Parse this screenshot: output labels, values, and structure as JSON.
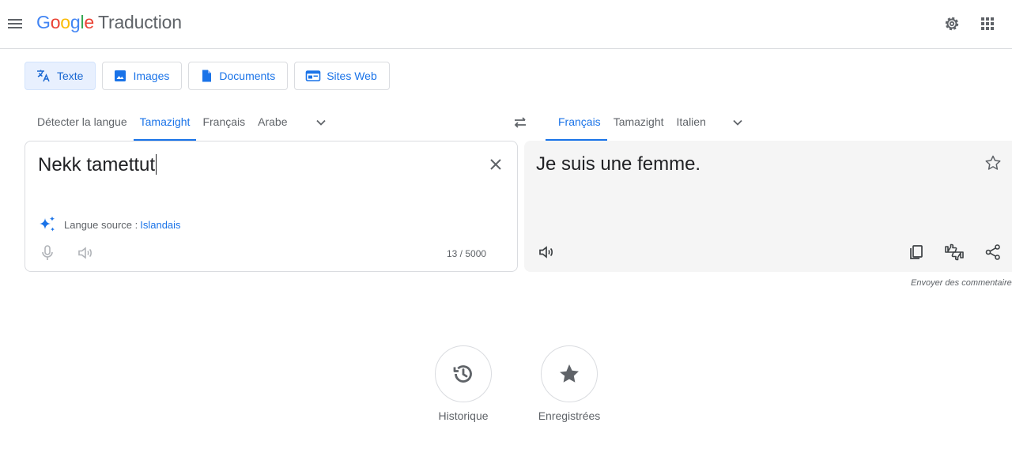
{
  "app": {
    "logo": [
      "G",
      "o",
      "o",
      "g",
      "l",
      "e"
    ],
    "product_name": "Traduction"
  },
  "modes": [
    {
      "label": "Texte",
      "icon": "translate-icon",
      "active": true
    },
    {
      "label": "Images",
      "icon": "image-icon",
      "active": false
    },
    {
      "label": "Documents",
      "icon": "document-icon",
      "active": false
    },
    {
      "label": "Sites Web",
      "icon": "web-icon",
      "active": false
    }
  ],
  "source": {
    "languages": [
      "Détecter la langue",
      "Tamazight",
      "Français",
      "Arabe"
    ],
    "active_index": 1,
    "text": "Nekk tamettut",
    "detected_prefix": "Langue source :",
    "detected_language": "Islandais",
    "char_count": "13 / 5000"
  },
  "target": {
    "languages": [
      "Français",
      "Tamazight",
      "Italien"
    ],
    "active_index": 0,
    "text": "Je suis une femme."
  },
  "feedback_label": "Envoyer des commentaires",
  "actions": {
    "history_label": "Historique",
    "saved_label": "Enregistrées"
  },
  "colors": {
    "accent": "#1a73e8",
    "active_tab_bg": "#e8f0fe",
    "target_panel_bg": "#f5f5f5"
  }
}
